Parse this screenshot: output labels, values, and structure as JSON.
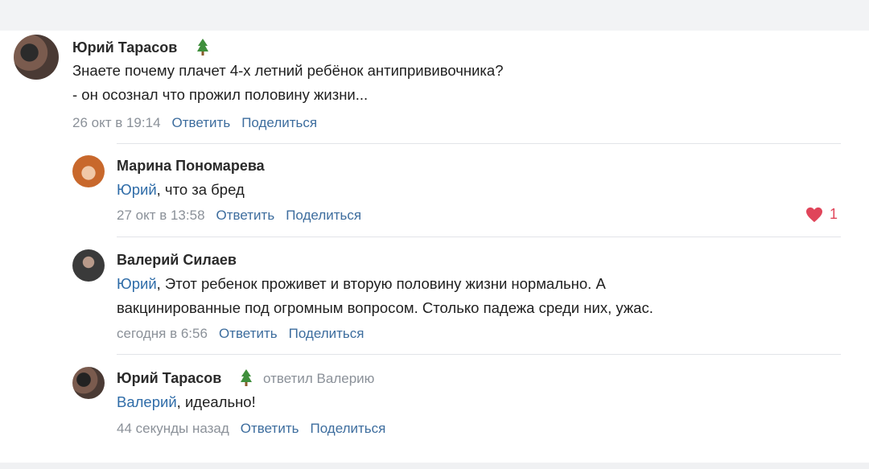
{
  "comments": [
    {
      "author": "Юрий Тарасов",
      "text_lines": [
        "Знаете почему плачет 4-х летний ребёнок антипрививочника?",
        "- он осознал что прожил половину жизни..."
      ],
      "time": "26 окт в 19:14",
      "reply_label": "Ответить",
      "share_label": "Поделиться"
    },
    {
      "author": "Марина Пономарева",
      "mention": "Юрий",
      "text_lines": [
        ", что за бред"
      ],
      "time": "27 окт в 13:58",
      "reply_label": "Ответить",
      "share_label": "Поделиться",
      "likes": "1"
    },
    {
      "author": "Валерий Силаев",
      "mention": "Юрий",
      "text_lines": [
        ", Этот ребенок проживет и вторую половину жизни нормально. А",
        "вакцинированные под огромным вопросом. Столько падежа среди них, ужас."
      ],
      "time": "сегодня в 6:56",
      "reply_label": "Ответить",
      "share_label": "Поделиться"
    },
    {
      "author": "Юрий Тарасов",
      "replied_to": "ответил Валерию",
      "mention": "Валерий",
      "text_lines": [
        ", идеально!"
      ],
      "time": "44 секунды назад",
      "reply_label": "Ответить",
      "share_label": "Поделиться"
    }
  ],
  "colors": {
    "link": "#3d6d9e",
    "mention": "#2f6ca8",
    "muted": "#8b9199",
    "like": "#e0455a"
  },
  "icons": [
    "christmas-tree-icon",
    "heart-icon"
  ]
}
